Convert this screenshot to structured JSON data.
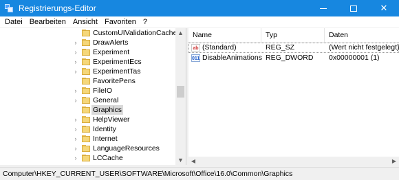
{
  "window": {
    "title": "Registrierungs-Editor",
    "controls": {
      "minimize": "",
      "maximize": "",
      "close": "✕"
    }
  },
  "menu": [
    "Datei",
    "Bearbeiten",
    "Ansicht",
    "Favoriten",
    "?"
  ],
  "tree": {
    "items": [
      {
        "label": "CustomUIValidationCache",
        "expandable": false
      },
      {
        "label": "DrawAlerts",
        "expandable": true
      },
      {
        "label": "Experiment",
        "expandable": true
      },
      {
        "label": "ExperimentEcs",
        "expandable": true
      },
      {
        "label": "ExperimentTas",
        "expandable": true
      },
      {
        "label": "FavoritePens",
        "expandable": false
      },
      {
        "label": "FileIO",
        "expandable": true
      },
      {
        "label": "General",
        "expandable": true
      },
      {
        "label": "Graphics",
        "expandable": false,
        "selected": true
      },
      {
        "label": "HelpViewer",
        "expandable": true
      },
      {
        "label": "Identity",
        "expandable": true
      },
      {
        "label": "Internet",
        "expandable": true
      },
      {
        "label": "LanguageResources",
        "expandable": true
      },
      {
        "label": "LCCache",
        "expandable": true
      }
    ]
  },
  "values": {
    "columns": {
      "name": "Name",
      "type": "Typ",
      "data": "Daten"
    },
    "rows": [
      {
        "icon": "ab",
        "icon_kind": "string-value-icon",
        "name": "(Standard)",
        "type": "REG_SZ",
        "data": "(Wert nicht festgelegt)"
      },
      {
        "icon": "011",
        "icon_kind": "dword-value-icon",
        "name": "DisableAnimations",
        "type": "REG_DWORD",
        "data": "0x00000001 (1)"
      }
    ]
  },
  "status": {
    "path": "Computer\\HKEY_CURRENT_USER\\SOFTWARE\\Microsoft\\Office\\16.0\\Common\\Graphics"
  },
  "colors": {
    "titlebar": "#1787e0",
    "selection": "#d9d9d9",
    "folder": "#f5d77a"
  }
}
